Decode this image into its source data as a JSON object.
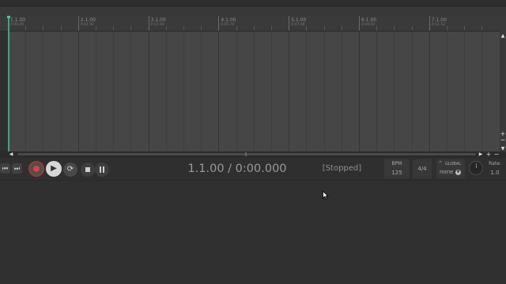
{
  "ruler": {
    "markers": [
      {
        "main": "1.1.00",
        "sub": "0:00.00"
      },
      {
        "main": "2.1.00",
        "sub": "0:01.92"
      },
      {
        "main": "3.1.00",
        "sub": "0:03.84"
      },
      {
        "main": "4.1.00",
        "sub": "0:05.76"
      },
      {
        "main": "5.1.00",
        "sub": "0:07.68"
      },
      {
        "main": "6.1.00",
        "sub": "0:09.60"
      },
      {
        "main": "7.1.00",
        "sub": "0:11.52"
      }
    ]
  },
  "transport": {
    "time_display": "1.1.00 / 0:00.000",
    "status": "[Stopped]",
    "bpm_label": "BPM",
    "bpm_value": "125",
    "time_signature": "4/4",
    "global_label": "GLOBAL",
    "global_value": "none",
    "rate_label": "Rate:",
    "rate_value": "1.0"
  },
  "icons": {
    "go_start": "skip-back-icon",
    "go_end": "skip-forward-icon",
    "record": "record-icon",
    "play": "play-icon",
    "loop": "loop-icon",
    "stop": "stop-icon",
    "pause": "pause-icon"
  },
  "colors": {
    "playhead": "#3aa68a",
    "record": "#d04545",
    "background": "#303030"
  }
}
